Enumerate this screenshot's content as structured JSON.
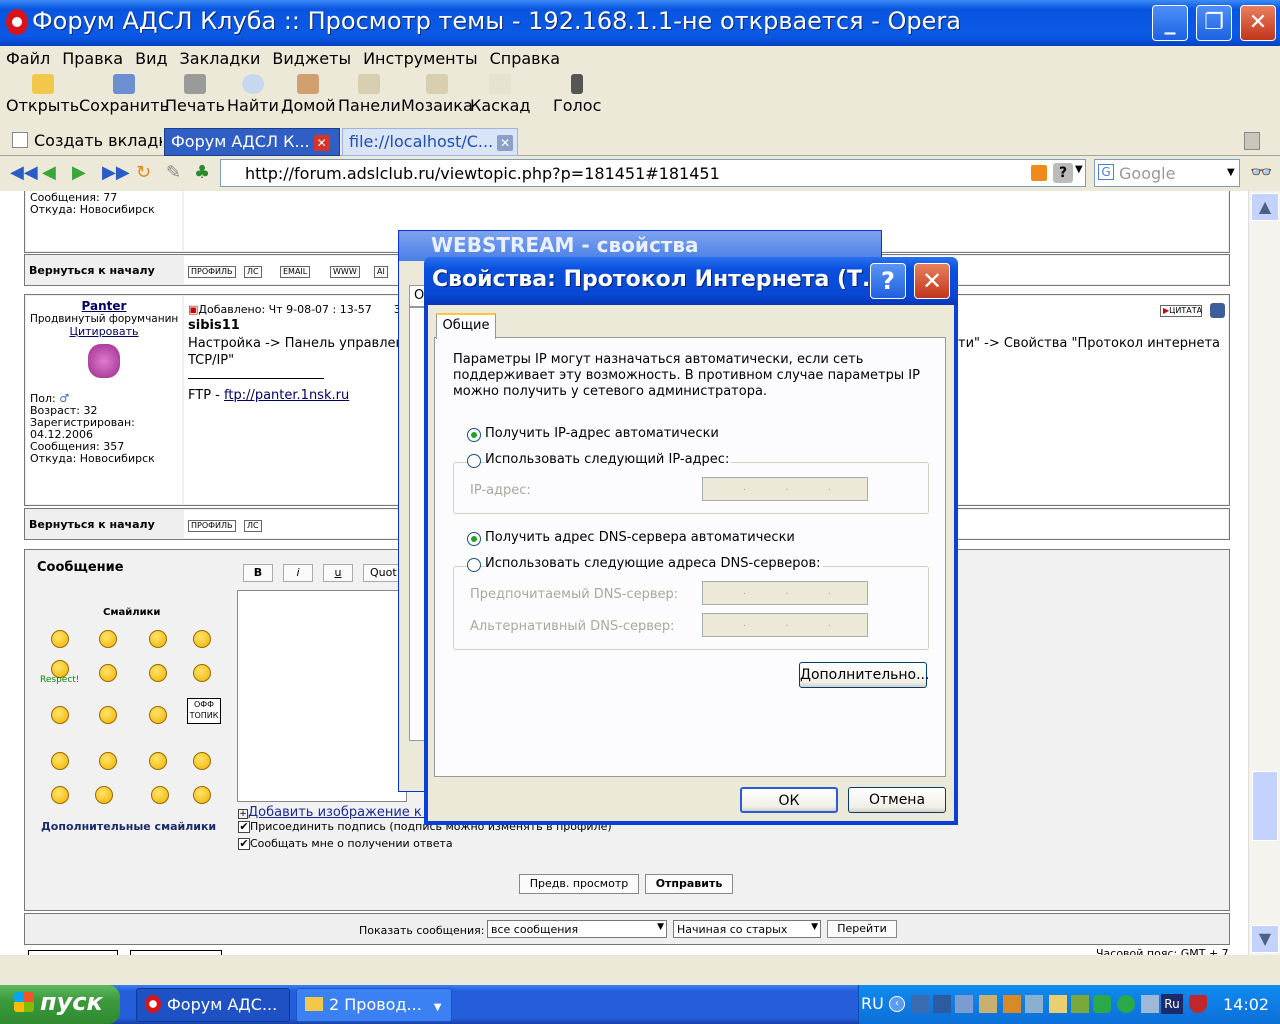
{
  "window": {
    "title": "Форум АДСЛ Клуба :: Просмотр темы - 192.168.1.1-не открвается - Opera"
  },
  "menu": [
    "Файл",
    "Правка",
    "Вид",
    "Закладки",
    "Виджеты",
    "Инструменты",
    "Справка"
  ],
  "toolbar": {
    "open": "Открыть",
    "save": "Сохранить",
    "print": "Печать",
    "find": "Найти",
    "home": "Домой",
    "panels": "Панели",
    "tile": "Мозаика",
    "cascade": "Каскад",
    "voice": "Голос"
  },
  "tabs": {
    "new_tab": "Создать вкладку",
    "tab1": "Форум АДСЛ К...",
    "tab2": "file://localhost/C..."
  },
  "address": {
    "url": "http://forum.adslclub.ru/viewtopic.php?p=181451#181451",
    "search_placeholder": "Google"
  },
  "forum": {
    "post1": {
      "messages": "Сообщения: 77",
      "location": "Откуда: Новосибирск"
    },
    "back_to_top": "Вернуться к началу",
    "post2": {
      "author": "Panter",
      "rank": "Продвинутый форумчанин",
      "quote_link": "Цитировать",
      "gender": "Пол:",
      "age": "Возраст: 32",
      "registered": "Зарегистрирован:",
      "reg_date": "04.12.2006",
      "messages": "Сообщения: 357",
      "location": "Откуда: Новосибирск",
      "posted": "Добавлено: Чт 9-08-07 : 13-57",
      "posted_tail": "З",
      "subject": "sibis11",
      "body_left": "Настройка -> Панель управлени",
      "body_right": "ти\" -> Свойства \"Протокол интернета",
      "body_cont": "TCP/IP\"",
      "signature_prefix": "FTP - ",
      "signature_link": "ftp://panter.1nsk.ru",
      "quote_btn": "ЦИТАТА"
    },
    "btn_profile": "ПРОФИЛЬ",
    "btn_pm": "ЛС",
    "btn_email": "EMAIL",
    "btn_www": "WWW",
    "btn_aim": "AI",
    "reply": {
      "message_label": "Сообщение",
      "smilies": "Смайлики",
      "respect": "Respect!",
      "offtopic": "ОФФ ТОПИК",
      "more_smilies": "Дополнительные смайлики",
      "bold": "B",
      "italic": "i",
      "underline": "u",
      "quote": "Quot",
      "add_image": "Добавить изображение к с",
      "attach_sig": "Присоединить подпись (подпись можно изменять в профиле)",
      "notify": "Сообщать мне о получении ответа",
      "preview": "Предв. просмотр",
      "submit": "Отправить"
    },
    "show_label": "Показать сообщения:",
    "show_value": "все сообщения",
    "order_value": "Начиная со старых",
    "go": "Перейти",
    "tz": "Часовой пояс: GMT + 7"
  },
  "dialog_back": {
    "title": "WEBSTREAM - свойства",
    "tab_letter": "О"
  },
  "dialog": {
    "title": "Свойства: Протокол Интернета (Т...",
    "tab": "Общие",
    "desc1": "Параметры IP могут назначаться автоматически, если сеть",
    "desc2": "поддерживает эту возможность. В противном случае параметры IP",
    "desc3": "можно получить у сетевого администратора.",
    "ip_auto": "Получить IP-адрес автоматически",
    "ip_manual": "Использовать следующий IP-адрес:",
    "ip_label": "IP-адрес:",
    "dns_auto": "Получить адрес DNS-сервера автоматически",
    "dns_manual": "Использовать следующие адреса DNS-серверов:",
    "dns_pref": "Предпочитаемый DNS-сервер:",
    "dns_alt": "Альтернативный DNS-сервер:",
    "advanced": "Дополнительно...",
    "ok": "ОК",
    "cancel": "Отмена",
    "ip_placeholder": ". . ."
  },
  "taskbar": {
    "start": "пуск",
    "task1": "Форум АДС...",
    "task2": "2 Провод...",
    "lang": "RU",
    "lang2": "Ru",
    "clock": "14:02"
  }
}
